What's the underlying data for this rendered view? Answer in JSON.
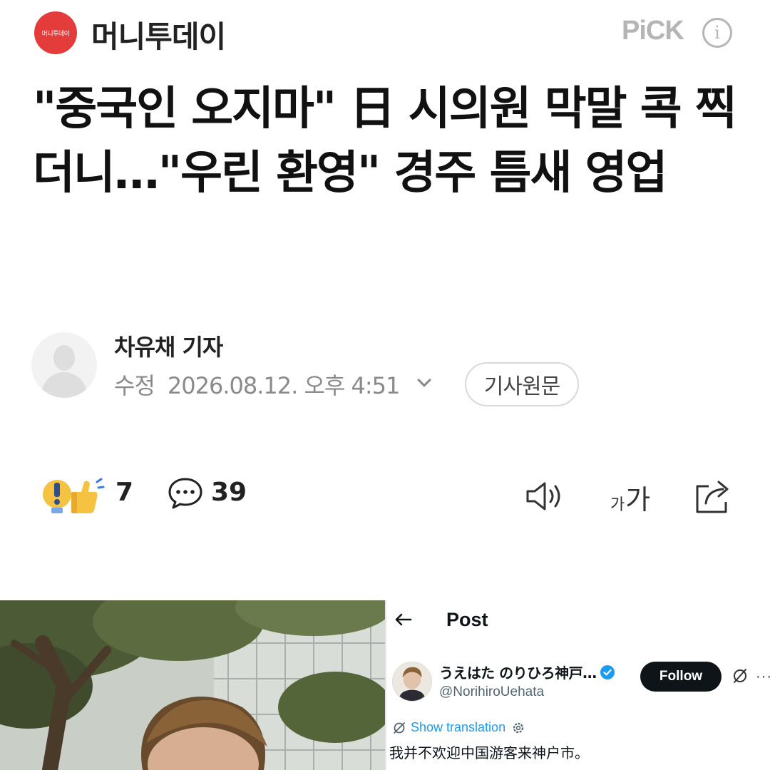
{
  "header": {
    "logo_text": "머니투데이",
    "press_name": "머니투데이",
    "pick_label": "PiCK",
    "info_icon": "info-icon"
  },
  "article": {
    "headline": "\"중국인 오지마\" 日 시의원 막말 콕 찍더니…\"우린 환영\" 경주 틈새 영업",
    "reporter": "차유채 기자",
    "modified_label": "수정",
    "timestamp": "2026.08.12. 오후 4:51",
    "original_button": "기사원문"
  },
  "reactions": {
    "reaction_count": "7",
    "comment_count": "39",
    "font_size_small": "가",
    "font_size_large": "가",
    "icons": [
      "reaction-thumbs-up-icon",
      "comment-icon",
      "speaker-icon",
      "font-size-icon",
      "share-icon"
    ]
  },
  "embedded_post": {
    "title": "Post",
    "display_name": "うえはた のりひろ神戸…",
    "handle": "@NorihiroUehata",
    "follow_label": "Follow",
    "more": "···",
    "show_translation": "Show translation",
    "text": "我并不欢迎中国游客来神户市。"
  },
  "colors": {
    "brand_red": "#e43b3b",
    "pick_gray": "#b5b5b5",
    "twitter_blue": "#1d9bf0",
    "follow_black": "#0f1419"
  }
}
